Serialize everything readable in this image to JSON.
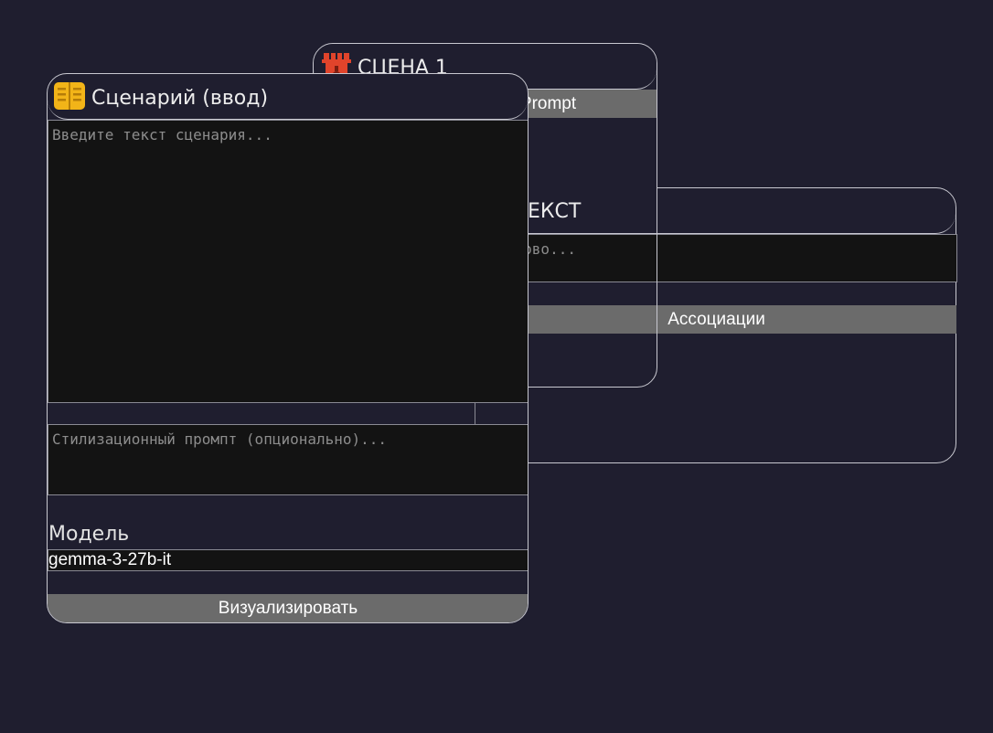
{
  "scene_node": {
    "title": "СЦЕНА 1",
    "icon": "tower-icon",
    "generate_button": "Сгенерировать Prompt"
  },
  "context_node": {
    "title_visible": "ЕКСТ",
    "input_placeholder_visible": "те слово...",
    "associations_button": "Ассоциации"
  },
  "script_node": {
    "title": "Сценарий (ввод)",
    "icon": "open-book-icon",
    "script_placeholder": "Введите текст сценария...",
    "style_placeholder": "Стилизационный промпт (опционально)...",
    "model_label": "Модель",
    "model_value": "gemma-3-27b-it",
    "visualize_button": "Визуализировать"
  },
  "colors": {
    "background": "#1f1e2f",
    "border": "#c8c8d0",
    "input_bg": "#131313",
    "button_bg": "#6b6b6b",
    "tower_icon": "#e0442b",
    "book_icon": "#f2b418"
  }
}
